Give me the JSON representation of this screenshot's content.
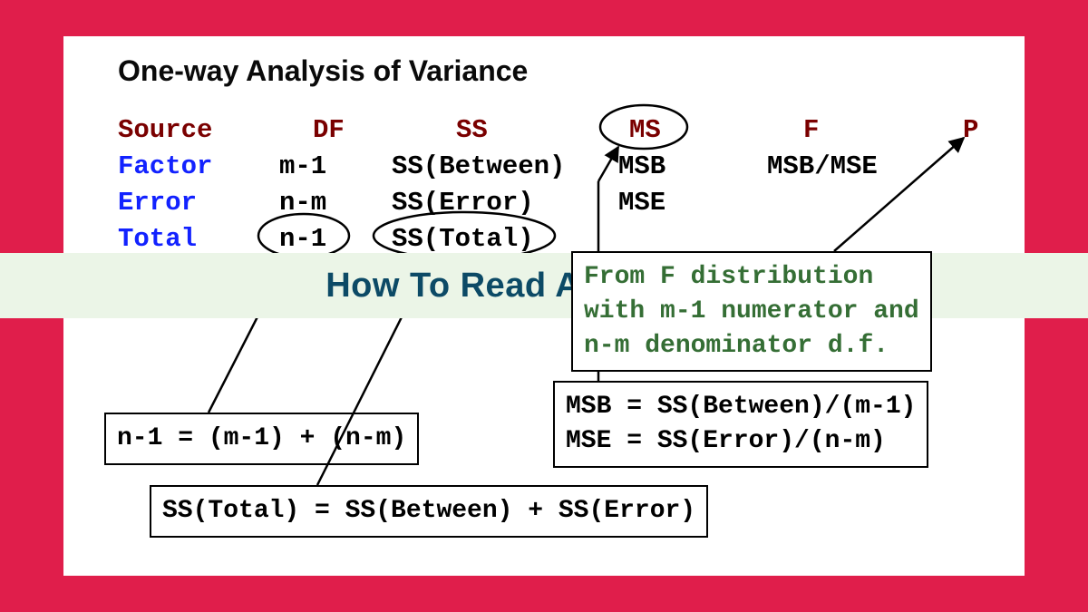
{
  "title": "One-way Analysis of Variance",
  "banner": "How To Read Anova Table",
  "headers": {
    "source": "Source",
    "df": "DF",
    "ss": "SS",
    "ms": "MS",
    "f": "F",
    "p": "P"
  },
  "rows": {
    "factor": {
      "label": "Factor",
      "df": "m-1",
      "ss": "SS(Between)",
      "ms": "MSB",
      "f": "MSB/MSE"
    },
    "error": {
      "label": "Error",
      "df": "n-m",
      "ss": "SS(Error)",
      "ms": "MSE"
    },
    "total": {
      "label": "Total",
      "df": "n-1",
      "ss": "SS(Total)"
    }
  },
  "formulas": {
    "df_total": "n-1 = (m-1) + (n-m)",
    "ss_total": "SS(Total) = SS(Between) + SS(Error)",
    "msb": "MSB = SS(Between)/(m-1)",
    "mse": "MSE = SS(Error)/(n-m)",
    "fdist1": "From F distribution",
    "fdist2": "with m-1 numerator and",
    "fdist3": "n-m denominator d.f."
  }
}
